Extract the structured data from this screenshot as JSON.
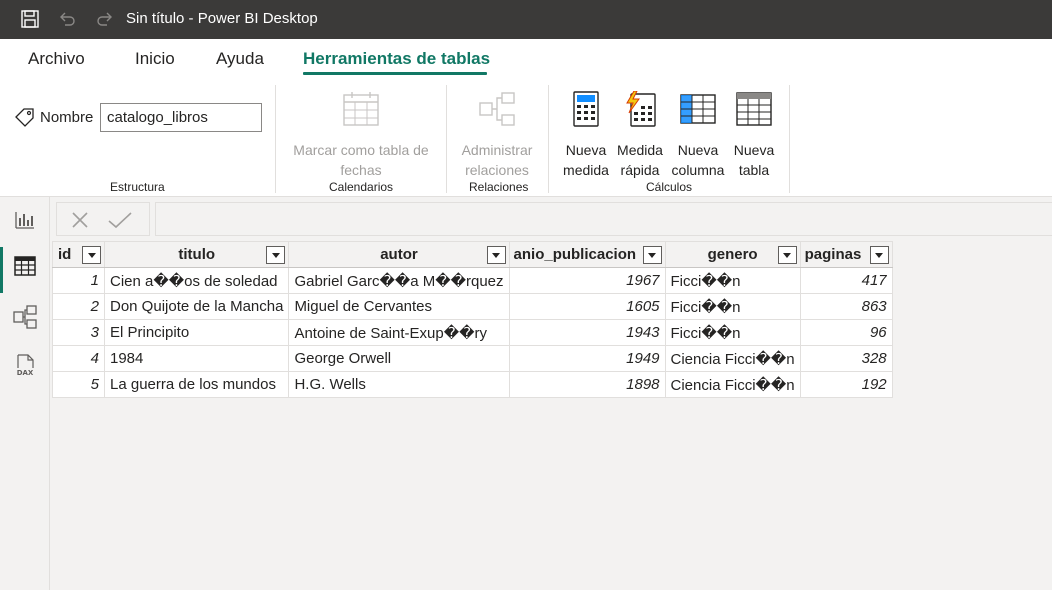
{
  "app": {
    "title": "Sin título - Power BI Desktop"
  },
  "tabs": [
    {
      "label": "Archivo"
    },
    {
      "label": "Inicio"
    },
    {
      "label": "Ayuda"
    },
    {
      "label": "Herramientas de tablas"
    }
  ],
  "ribbon": {
    "name_label": "Nombre",
    "name_value": "catalogo_libros",
    "mark_date": [
      "Marcar como tabla de",
      "fechas"
    ],
    "manage_rel": [
      "Administrar",
      "relaciones"
    ],
    "new_measure": [
      "Nueva",
      "medida"
    ],
    "quick_measure": [
      "Medida",
      "rápida"
    ],
    "new_column": [
      "Nueva",
      "columna"
    ],
    "new_table": [
      "Nueva",
      "tabla"
    ],
    "groups": {
      "structure": "Estructura",
      "calendars": "Calendarios",
      "relations": "Relaciones",
      "calculations": "Cálculos"
    }
  },
  "table": {
    "columns": [
      "id",
      "titulo",
      "autor",
      "anio_publicacion",
      "genero",
      "paginas"
    ],
    "rows": [
      [
        "1",
        "Cien a��os de soledad",
        "Gabriel Garc��a M��rquez",
        "1967",
        "Ficci��n",
        "417"
      ],
      [
        "2",
        "Don Quijote de la Mancha",
        "Miguel de Cervantes",
        "1605",
        "Ficci��n",
        "863"
      ],
      [
        "3",
        "El Principito",
        "Antoine de Saint-Exup��ry",
        "1943",
        "Ficci��n",
        "96"
      ],
      [
        "4",
        "1984",
        "George Orwell",
        "1949",
        "Ciencia Ficci��n",
        "328"
      ],
      [
        "5",
        "La guerra de los mundos",
        "H.G. Wells",
        "1898",
        "Ciencia Ficci��n",
        "192"
      ]
    ]
  },
  "colors": {
    "accent": "#117865",
    "titlebar": "#3b3a39"
  },
  "icons": [
    "save-icon",
    "undo-icon",
    "redo-icon",
    "tag-icon",
    "calendar-table-icon",
    "relationships-icon",
    "new-measure-icon",
    "quick-measure-icon",
    "new-column-icon",
    "new-table-icon",
    "report-view-icon",
    "data-view-icon",
    "model-view-icon",
    "dax-query-icon",
    "cancel-x-icon",
    "commit-check-icon"
  ]
}
